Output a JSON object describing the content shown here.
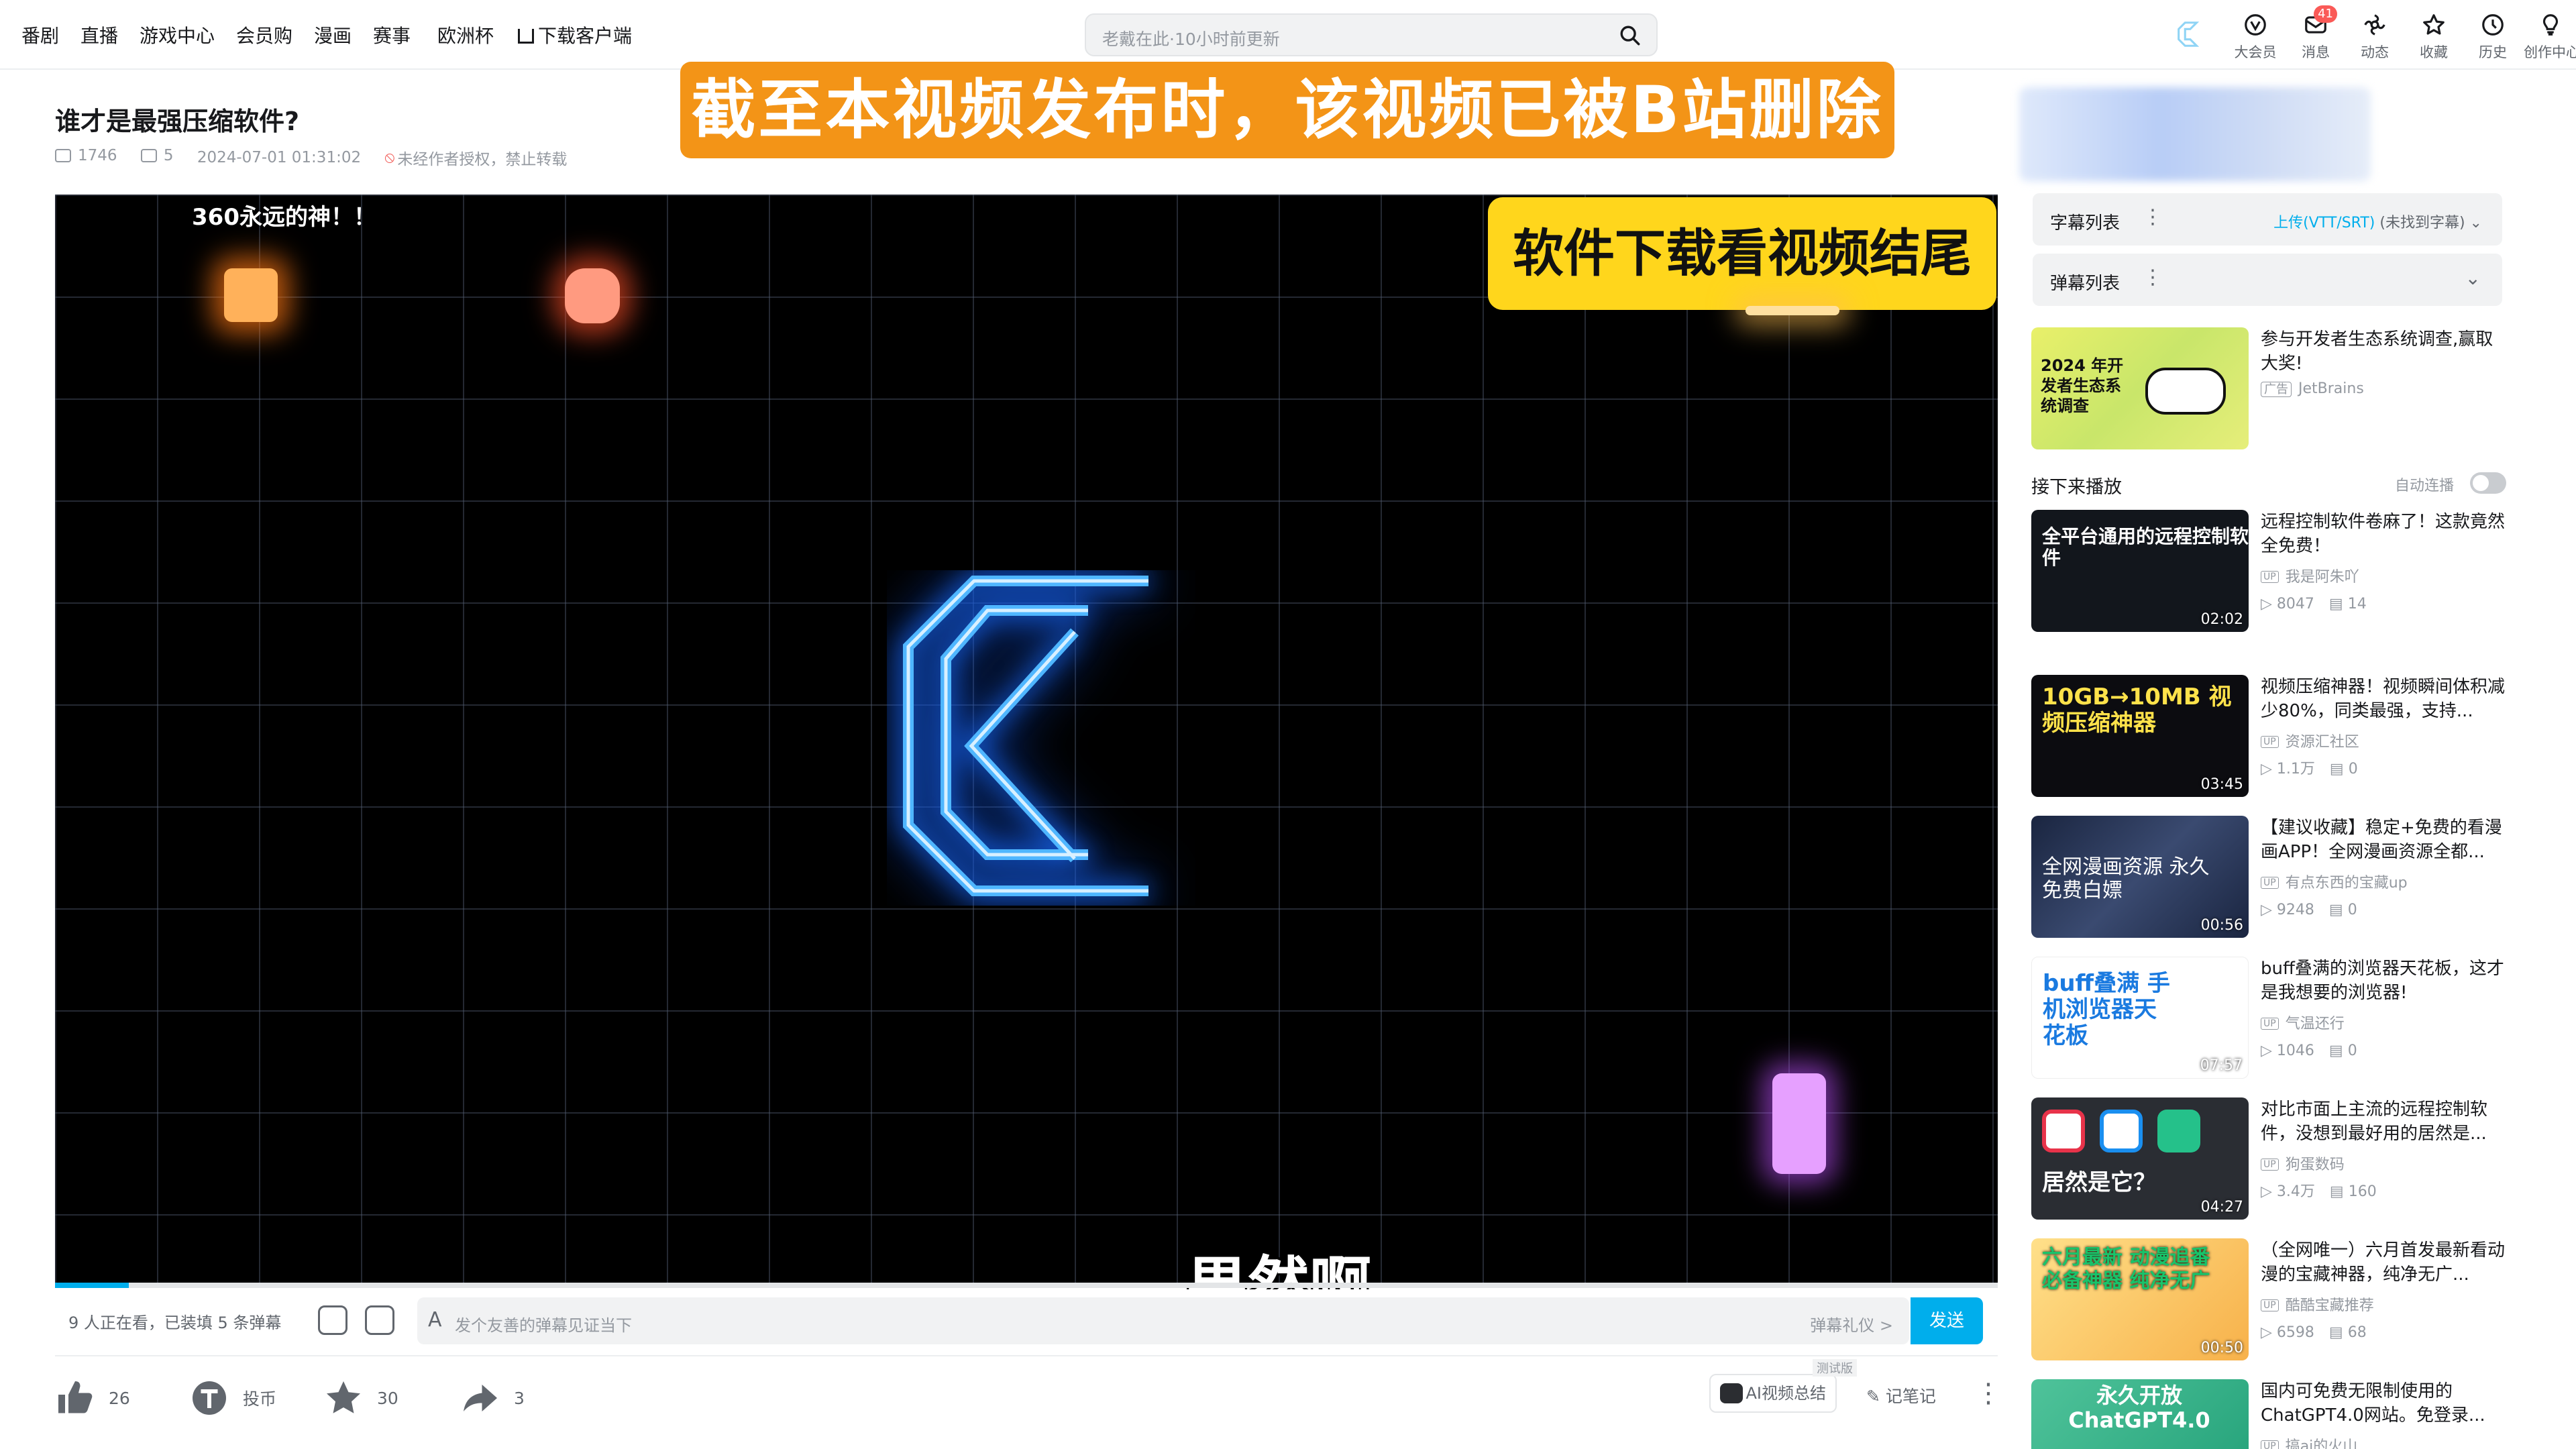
{
  "header": {
    "nav": [
      "番剧",
      "直播",
      "游戏中心",
      "会员购",
      "漫画",
      "赛事",
      "欧洲杯",
      "下载客户端"
    ],
    "search_placeholder": "老戴在此·10小时前更新",
    "icons": [
      {
        "label": "大会员",
        "icon": "vip-icon"
      },
      {
        "label": "消息",
        "icon": "message-icon",
        "badge": "41"
      },
      {
        "label": "动态",
        "icon": "dynamic-icon"
      },
      {
        "label": "收藏",
        "icon": "favorite-icon"
      },
      {
        "label": "历史",
        "icon": "history-icon"
      },
      {
        "label": "创作中心",
        "icon": "creator-icon"
      }
    ]
  },
  "video": {
    "title": "谁才是最强压缩软件?",
    "views": "1746",
    "danmaku": "5",
    "date": "2024-07-01 01:31:02",
    "copyright": "未经作者授权，禁止转载",
    "banner": "截至本视频发布时，该视频已被B站删除",
    "overlay_corner": "360永远的神！！",
    "overlay_tag": "软件下载看视频结尾",
    "subtitle": "果然啊",
    "accent": "#00aeec"
  },
  "danmaku_bar": {
    "watching": "9 人正在看，已装填 5 条弹幕",
    "placeholder": "发个友善的弹幕见证当下",
    "etiquette": "弹幕礼仪 >",
    "send": "发送"
  },
  "actions": {
    "like": "26",
    "coin": "投币",
    "favorite": "30",
    "share": "3",
    "ai_summary": "AI视频总结",
    "beta": "测试版",
    "notes": "记笔记"
  },
  "sidebar": {
    "subtitle_list": "字幕列表",
    "subtitle_upload": "上传(VTT/SRT)",
    "subtitle_none": "(未找到字幕)",
    "danmaku_list": "弹幕列表",
    "ad": {
      "title": "参与开发者生态系统调查,赢取大奖!",
      "tag": "广告",
      "source": "JetBrains",
      "thumb_text": "2024 年开发者生态系统调查"
    },
    "next_label": "接下来播放",
    "autoplay_label": "自动连播",
    "recommendations": [
      {
        "title": "远程控制软件卷麻了！这款竟然全免费！",
        "up": "我是阿朱吖",
        "views": "8047",
        "danmaku": "14",
        "duration": "02:02",
        "thumb": "全平台通用的远程控制软件"
      },
      {
        "title": "视频压缩神器！视频瞬间体积减少80%，同类最强，支持...",
        "up": "资源汇社区",
        "views": "1.1万",
        "danmaku": "0",
        "duration": "03:45",
        "thumb": "10GB→10MB 视频压缩神器"
      },
      {
        "title": "【建议收藏】稳定+免费的看漫画APP！全网漫画资源全都...",
        "up": "有点东西的宝藏up",
        "views": "9248",
        "danmaku": "0",
        "duration": "00:56",
        "thumb": "全网漫画资源 永久免费白嫖"
      },
      {
        "title": "buff叠满的浏览器天花板，这才是我想要的浏览器!",
        "up": "气温还行",
        "views": "1046",
        "danmaku": "0",
        "duration": "07:57",
        "thumb": "buff叠满 手机浏览器天花板"
      },
      {
        "title": "对比市面上主流的远程控制软件，没想到最好用的居然是...",
        "up": "狗蛋数码",
        "views": "3.4万",
        "danmaku": "160",
        "duration": "04:27",
        "thumb": "居然是它？"
      },
      {
        "title": "（全网唯一）六月首发最新看动漫的宝藏神器，纯净无广...",
        "up": "酷酷宝藏推荐",
        "views": "6598",
        "danmaku": "68",
        "duration": "00:50",
        "thumb": "六月最新 动漫追番 必备神器 纯净无广"
      },
      {
        "title": "国内可免费无限制使用的ChatGPT4.0网站。免登录...",
        "up": "搞ai的火山",
        "views": "",
        "danmaku": "",
        "duration": "",
        "thumb": "永久开放 ChatGPT4.0"
      }
    ]
  }
}
